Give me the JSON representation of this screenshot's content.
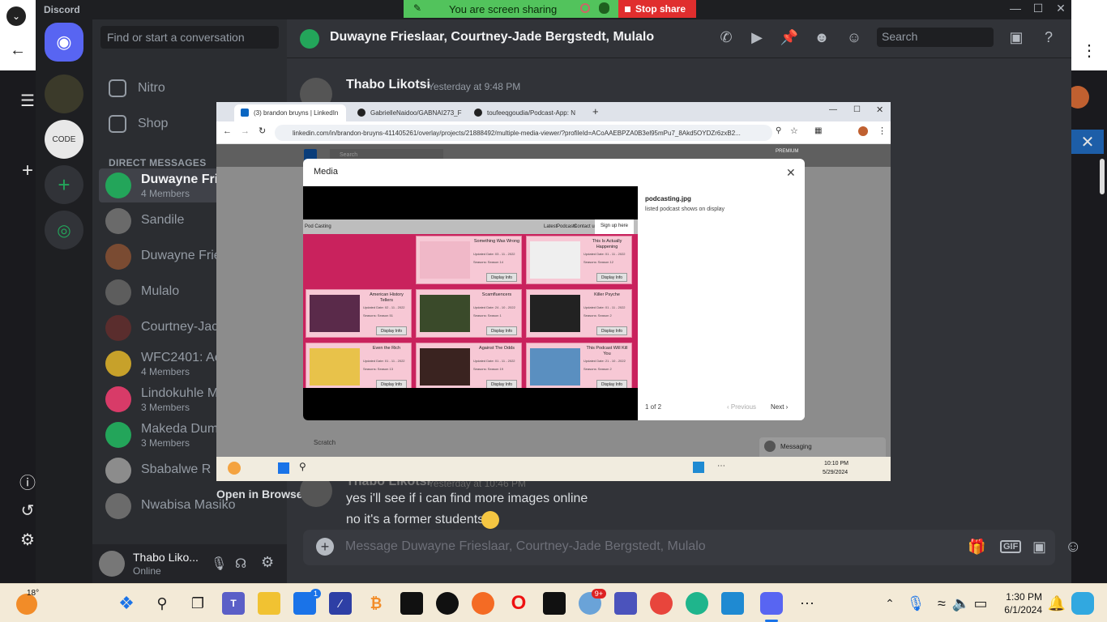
{
  "discord": {
    "app_name": "Discord",
    "dm_search_placeholder": "Find or start a conversation",
    "nav": {
      "nitro": "Nitro",
      "shop": "Shop"
    },
    "direct_messages_header": "DIRECT MESSAGES",
    "code_server_label": "CODE",
    "dms": [
      {
        "name": "Duwayne Frie",
        "sub": "4 Members",
        "color": "#23a55a",
        "active": true
      },
      {
        "name": "Sandile",
        "sub": "",
        "color": "#6a6a6a"
      },
      {
        "name": "Duwayne Frie",
        "sub": "",
        "color": "#7a4b32"
      },
      {
        "name": "Mulalo",
        "sub": "",
        "color": "#5d5d5d"
      },
      {
        "name": "Courtney-Jac",
        "sub": "",
        "color": "#5a2d2d"
      },
      {
        "name": "WFC2401: Ac",
        "sub": "4 Members",
        "color": "#c7a12a"
      },
      {
        "name": "Lindokuhle M",
        "sub": "3 Members",
        "color": "#d83b68"
      },
      {
        "name": "Makeda Dum",
        "sub": "3 Members",
        "color": "#23a55a"
      },
      {
        "name": "Sbabalwe R",
        "sub": "",
        "color": "#8c8c8c"
      },
      {
        "name": "Nwabisa Masiko",
        "sub": "",
        "color": "#6b6b6b"
      }
    ],
    "user": {
      "name": "Thabo Liko...",
      "status": "Online"
    },
    "chat_title": "Duwayne Frieslaar, Courtney-Jade Bergstedt, Mulalo",
    "header_search": "Search",
    "messages": [
      {
        "author": "Thabo Likotsi",
        "time": "Yesterday at 9:48 PM"
      },
      {
        "author": "Thabo Likotsi",
        "time": "Yesterday at 10:46 PM",
        "lines": [
          "yes i'll see if i can find more images online",
          "no it's a former students'"
        ]
      }
    ],
    "open_in_browser": "Open in Browser",
    "composer_placeholder": "Message Duwayne Frieslaar, Courtney-Jade Bergstedt, Mulalo"
  },
  "share": {
    "status": "You are screen sharing",
    "stop": "Stop share"
  },
  "browser": {
    "tabs": [
      {
        "label": "(3) brandon bruyns | LinkedIn",
        "color": "#0a66c2",
        "active": true
      },
      {
        "label": "GabrielleNaidoo/GABNAI273_F",
        "color": "#222"
      },
      {
        "label": "toufeeqgoudia/Podcast-App: N",
        "color": "#222"
      }
    ],
    "url": "linkedin.com/in/brandon-bruyns-411405261/overlay/projects/21888492/multiple-media-viewer/?profileId=ACoAAEBPZA0B3el95mPu7_8Akd5OYDZr6zxB2...",
    "li_search": "Search",
    "premium": "PREMIUM",
    "scratch": "Scratch",
    "messaging": "Messaging"
  },
  "modal": {
    "title": "Media",
    "file_name": "podcasting.jpg",
    "description": "listed podcast shows on display",
    "counter": "1 of 2",
    "prev": "Previous",
    "next": "Next"
  },
  "podsite": {
    "brand": "Pod Casting",
    "nav": [
      "Latest",
      "Podcasts",
      "Contact us"
    ],
    "signup": "Sign up here",
    "button": "Display Info",
    "cards": [
      {
        "title": "Something Was Wrong",
        "date": "Updated Date: 03 - 11 - 2022",
        "seasons": "Seasons: Season 14",
        "thumb": "#f0b8c8"
      },
      {
        "title": "This Is Actually Happening",
        "date": "Updated Date: 01 - 11 - 2022",
        "seasons": "Seasons: Season 12",
        "thumb": "#efefef"
      },
      {
        "title": "American History Tellers",
        "date": "Updated Date: 02 - 11 - 2022",
        "seasons": "Seasons: Season 51",
        "thumb": "#5a2a4a"
      },
      {
        "title": "Scamfluencers",
        "date": "Updated Date: 24 - 10 - 2022",
        "seasons": "Seasons: Season 1",
        "thumb": "#3a4a2a"
      },
      {
        "title": "Killer Psyche",
        "date": "Updated Date: 01 - 11 - 2022",
        "seasons": "Seasons: Season 2",
        "thumb": "#222"
      },
      {
        "title": "Even the Rich",
        "date": "Updated Date: 01 - 11 - 2022",
        "seasons": "Seasons: Season 13",
        "thumb": "#e8c24a"
      },
      {
        "title": "Against The Odds",
        "date": "Updated Date: 01 - 11 - 2022",
        "seasons": "Seasons: Season 19",
        "thumb": "#3a2320"
      },
      {
        "title": "This Podcast Will Kill You",
        "date": "Updated Date: 21 - 10 - 2022",
        "seasons": "Seasons: Season 2",
        "thumb": "#5a8fc0"
      }
    ]
  },
  "inner_taskbar": {
    "time": "10:10 PM",
    "date": "5/29/2024"
  },
  "taskbar": {
    "weather": "18°",
    "time": "1:30 PM",
    "date": "6/1/2024",
    "badge_store": "1",
    "badge_app": "9+"
  }
}
